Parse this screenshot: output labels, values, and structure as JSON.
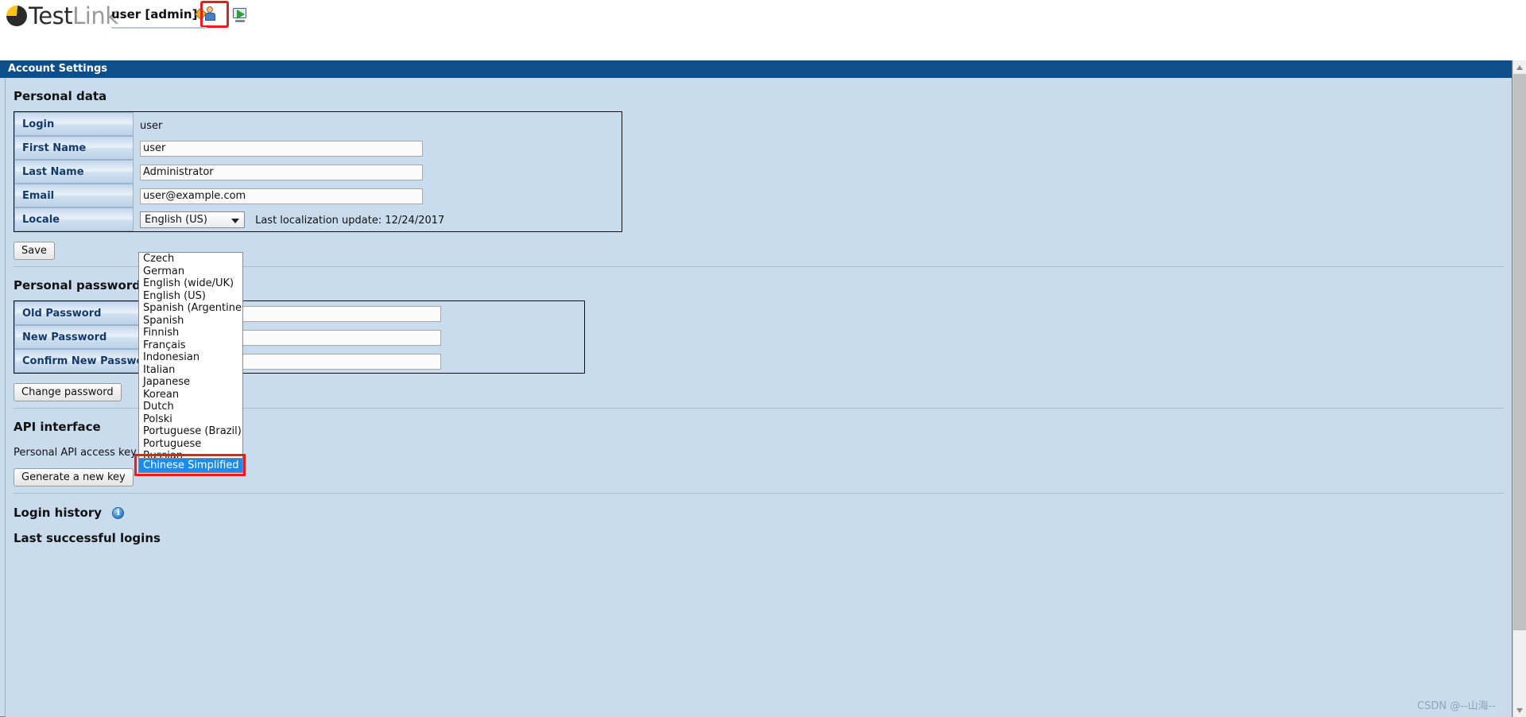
{
  "brand": {
    "name_dark": "Test",
    "name_soft": "Link"
  },
  "header": {
    "user_label": "user [admin]",
    "icons": [
      {
        "name": "user-settings-icon",
        "highlighted": true
      },
      {
        "name": "logout-screen-icon",
        "highlighted": false
      }
    ]
  },
  "panel": {
    "title": "Account Settings"
  },
  "personal_data": {
    "heading": "Personal data",
    "rows": [
      {
        "label": "Login",
        "type": "text",
        "value": "user"
      },
      {
        "label": "First Name",
        "type": "input",
        "value": "user"
      },
      {
        "label": "Last Name",
        "type": "input",
        "value": "Administrator"
      },
      {
        "label": "Email",
        "type": "input",
        "value": "user@example.com"
      },
      {
        "label": "Locale",
        "type": "select",
        "value": "English (US)"
      }
    ],
    "localization_note": "Last localization update: 12/24/2017",
    "save_label": "Save"
  },
  "locale_dropdown": {
    "open": true,
    "selected": "Chinese Simplified",
    "highlight_color": "#1a8cf0",
    "annotation_color": "#ef1b1b",
    "options": [
      "Czech",
      "German",
      "English (wide/UK)",
      "English (US)",
      "Spanish (Argentine)",
      "Spanish",
      "Finnish",
      "Français",
      "Indonesian",
      "Italian",
      "Japanese",
      "Korean",
      "Dutch",
      "Polski",
      "Portuguese (Brazil)",
      "Portuguese",
      "Russian"
    ]
  },
  "personal_password": {
    "heading": "Personal password",
    "rows": [
      {
        "label": "Old Password",
        "value": ""
      },
      {
        "label": "New Password",
        "value": ""
      },
      {
        "label": "Confirm New Password",
        "value": ""
      }
    ],
    "change_label": "Change password"
  },
  "api_interface": {
    "heading": "API interface",
    "key_text": "Personal API access key = None",
    "generate_label": "Generate a new key"
  },
  "login_history": {
    "heading": "Login history",
    "info_icon": "info-icon",
    "subheading": "Last successful logins"
  },
  "watermark": "CSDN @--山海--"
}
